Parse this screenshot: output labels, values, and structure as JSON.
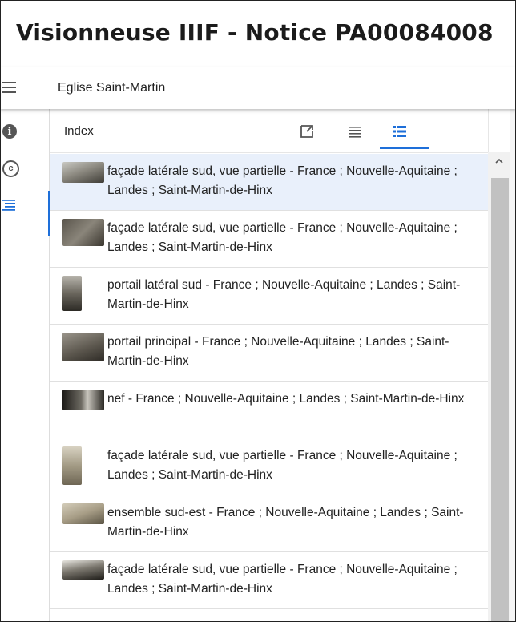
{
  "app": {
    "title": "Visionneuse IIIF - Notice PA00084008"
  },
  "menubar": {
    "label": "Eglise Saint-Martin",
    "menu_icon": "hamburger-menu-icon"
  },
  "rail": {
    "items": [
      {
        "icon": "info-icon",
        "glyph": "i"
      },
      {
        "icon": "copyright-icon",
        "glyph": "c"
      },
      {
        "icon": "index-list-icon"
      }
    ]
  },
  "panel": {
    "title": "Index",
    "tabs": [
      {
        "icon": "open-external-icon"
      },
      {
        "icon": "compact-list-icon"
      },
      {
        "icon": "thumbnail-list-icon",
        "active": true
      }
    ]
  },
  "colors": {
    "accent": "#1e6fd9",
    "selected_row": "#e9f0fb"
  },
  "items": [
    {
      "label": "façade latérale sud, vue partielle - France ; Nouvelle-Aquitaine ; Landes ; Saint-Martin-de-Hinx",
      "selected": true
    },
    {
      "label": "façade latérale sud, vue partielle - France ; Nouvelle-Aquitaine ; Landes ; Saint-Martin-de-Hinx"
    },
    {
      "label": "portail latéral sud - France ; Nouvelle-Aquitaine ; Landes ; Saint-Martin-de-Hinx"
    },
    {
      "label": "portail principal - France ; Nouvelle-Aquitaine ; Landes ; Saint-Martin-de-Hinx"
    },
    {
      "label": "nef - France ; Nouvelle-Aquitaine ; Landes ; Saint-Martin-de-Hinx"
    },
    {
      "label": "façade latérale sud, vue partielle - France ; Nouvelle-Aquitaine ; Landes ; Saint-Martin-de-Hinx"
    },
    {
      "label": "ensemble sud-est - France ; Nouvelle-Aquitaine ; Landes ; Saint-Martin-de-Hinx"
    },
    {
      "label": "façade latérale sud, vue partielle - France ; Nouvelle-Aquitaine ; Landes ; Saint-Martin-de-Hinx"
    }
  ]
}
